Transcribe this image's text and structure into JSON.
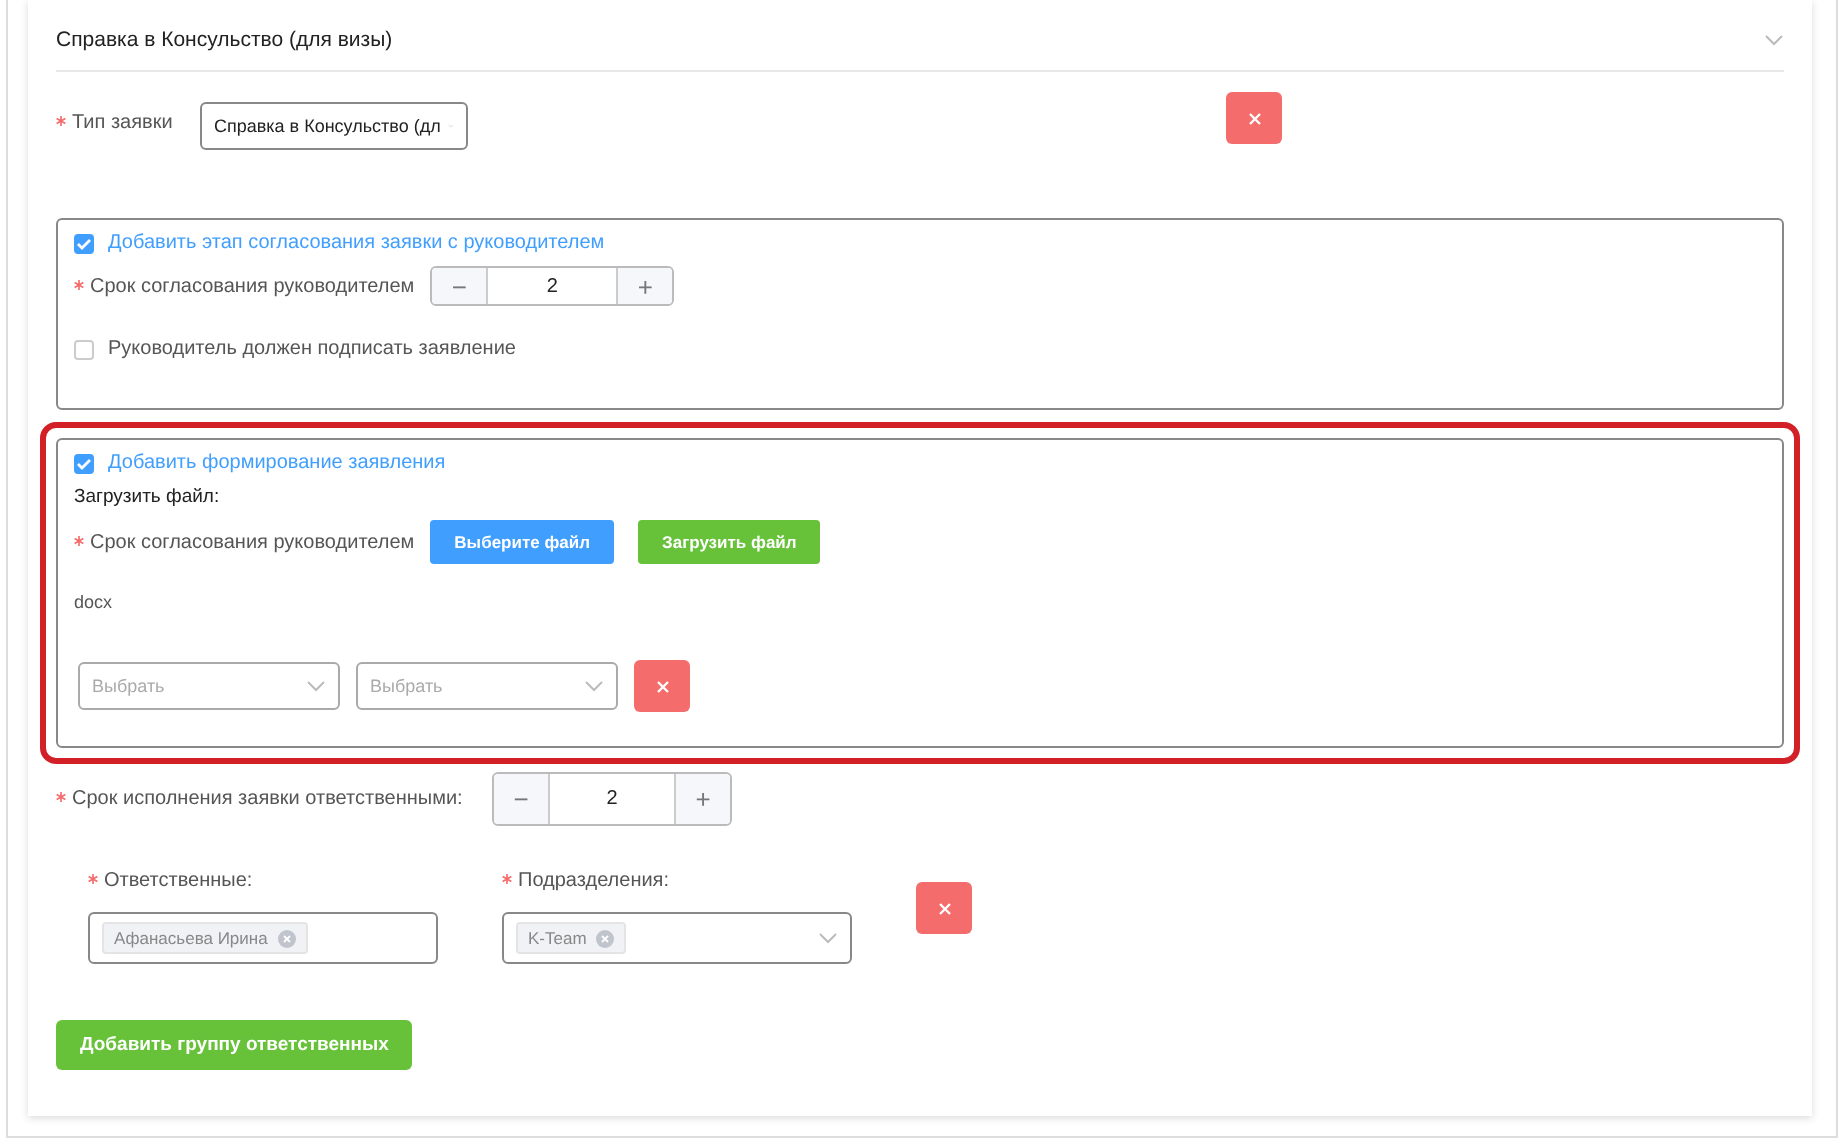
{
  "panel": {
    "title": "Справка в Консульство (для визы)",
    "expanded": true
  },
  "request_type": {
    "label": "Тип заявки",
    "required": true,
    "value": "Справка в Консульство (дл"
  },
  "manager_stage": {
    "checkbox": {
      "label": "Добавить этап согласования заявки с руководителем",
      "checked": true
    },
    "term": {
      "label": "Срок согласования руководителем",
      "required": true,
      "value": "2",
      "minus": "−",
      "plus": "+"
    },
    "sign": {
      "label": "Руководитель должен подписать заявление",
      "checked": false
    }
  },
  "statement_stage": {
    "highlighted": true,
    "checkbox": {
      "label": "Добавить формирование заявления",
      "checked": true
    },
    "upload_label": "Загрузить файл:",
    "term_label": "Срок согласования руководителем",
    "required": true,
    "choose_button": "Выберите файл",
    "upload_button": "Загрузить файл",
    "file_type": "docx",
    "selects": [
      {
        "placeholder": "Выбрать"
      },
      {
        "placeholder": "Выбрать"
      }
    ]
  },
  "execution_term": {
    "label": "Срок исполнения заявки ответственными:",
    "required": true,
    "value": "2",
    "minus": "−",
    "plus": "+"
  },
  "groups": [
    {
      "responsible": {
        "label": "Ответственные:",
        "required": true,
        "tags": [
          "Афанасьева Ирина"
        ]
      },
      "departments": {
        "label": "Подразделения:",
        "required": true,
        "tags": [
          "K-Team"
        ]
      }
    }
  ],
  "add_group_button": "Добавить группу ответственных"
}
